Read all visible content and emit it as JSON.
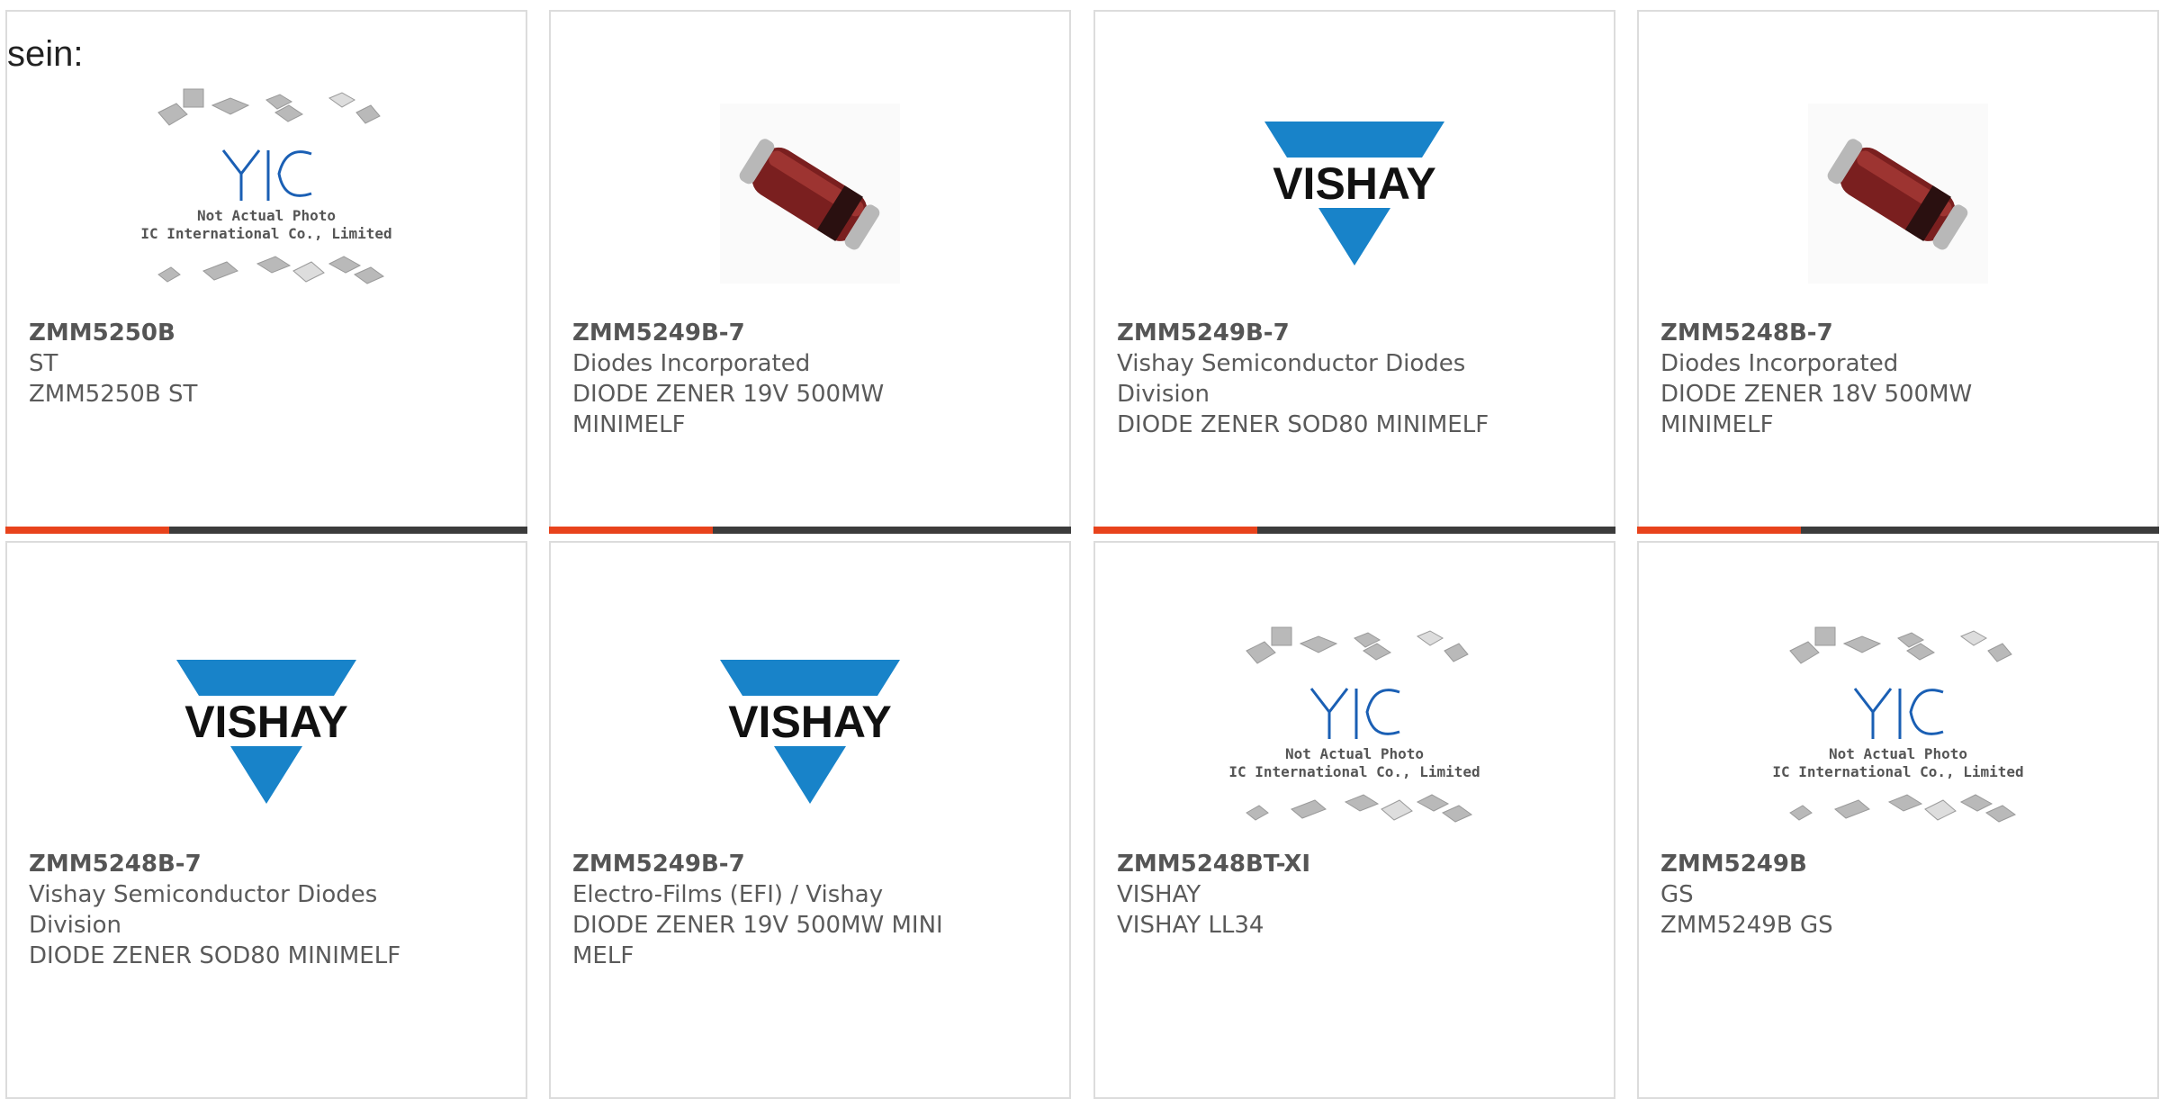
{
  "lead_text": "sein:",
  "theme": {
    "accent": "#e8431c",
    "bar_dark": "#3c3c3c",
    "vishay_blue": "#1883c9"
  },
  "products": [
    {
      "part": "ZMM5250B",
      "maker": "ST",
      "desc": "ZMM5250B ST",
      "image": "placeholder",
      "placeholder_text": [
        "Not Actual Photo",
        "YIC International Co., Limited."
      ]
    },
    {
      "part": "ZMM5249B-7",
      "maker": "Diodes Incorporated",
      "desc": "DIODE ZENER 19V 500MW MINIMELF",
      "image": "diode"
    },
    {
      "part": "ZMM5249B-7",
      "maker": "Vishay Semiconductor Diodes Division",
      "desc": "DIODE ZENER SOD80 MINIMELF",
      "image": "vishay",
      "logo_text": "VISHAY"
    },
    {
      "part": "ZMM5248B-7",
      "maker": "Diodes Incorporated",
      "desc": "DIODE ZENER 18V 500MW MINIMELF",
      "image": "diode"
    },
    {
      "part": "ZMM5248B-7",
      "maker": "Vishay Semiconductor Diodes Division",
      "desc": "DIODE ZENER SOD80 MINIMELF",
      "image": "vishay",
      "logo_text": "VISHAY"
    },
    {
      "part": "ZMM5249B-7",
      "maker": "Electro-Films (EFI) / Vishay",
      "desc": "DIODE ZENER 19V 500MW MINI MELF",
      "image": "vishay",
      "logo_text": "VISHAY"
    },
    {
      "part": "ZMM5248BT-XI",
      "maker": "VISHAY",
      "desc": "VISHAY LL34",
      "image": "placeholder",
      "placeholder_text": [
        "Not Actual Photo",
        "YIC International Co., Limited."
      ]
    },
    {
      "part": "ZMM5249B",
      "maker": "GS",
      "desc": "ZMM5249B GS",
      "image": "placeholder",
      "placeholder_text": [
        "Not Actual Photo",
        "YIC International Co., Limited."
      ]
    }
  ]
}
